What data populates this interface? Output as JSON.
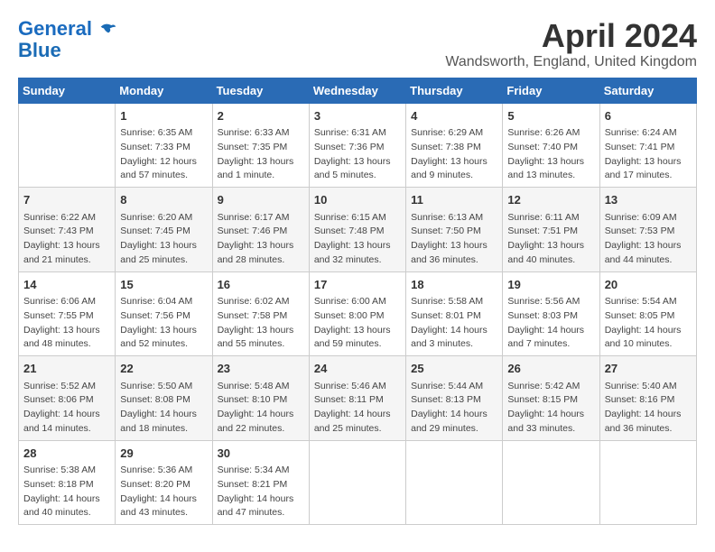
{
  "header": {
    "logo_line1": "General",
    "logo_line2": "Blue",
    "title": "April 2024",
    "location": "Wandsworth, England, United Kingdom"
  },
  "days_of_week": [
    "Sunday",
    "Monday",
    "Tuesday",
    "Wednesday",
    "Thursday",
    "Friday",
    "Saturday"
  ],
  "weeks": [
    [
      {
        "day": "",
        "sunrise": "",
        "sunset": "",
        "daylight": ""
      },
      {
        "day": "1",
        "sunrise": "Sunrise: 6:35 AM",
        "sunset": "Sunset: 7:33 PM",
        "daylight": "Daylight: 12 hours and 57 minutes."
      },
      {
        "day": "2",
        "sunrise": "Sunrise: 6:33 AM",
        "sunset": "Sunset: 7:35 PM",
        "daylight": "Daylight: 13 hours and 1 minute."
      },
      {
        "day": "3",
        "sunrise": "Sunrise: 6:31 AM",
        "sunset": "Sunset: 7:36 PM",
        "daylight": "Daylight: 13 hours and 5 minutes."
      },
      {
        "day": "4",
        "sunrise": "Sunrise: 6:29 AM",
        "sunset": "Sunset: 7:38 PM",
        "daylight": "Daylight: 13 hours and 9 minutes."
      },
      {
        "day": "5",
        "sunrise": "Sunrise: 6:26 AM",
        "sunset": "Sunset: 7:40 PM",
        "daylight": "Daylight: 13 hours and 13 minutes."
      },
      {
        "day": "6",
        "sunrise": "Sunrise: 6:24 AM",
        "sunset": "Sunset: 7:41 PM",
        "daylight": "Daylight: 13 hours and 17 minutes."
      }
    ],
    [
      {
        "day": "7",
        "sunrise": "Sunrise: 6:22 AM",
        "sunset": "Sunset: 7:43 PM",
        "daylight": "Daylight: 13 hours and 21 minutes."
      },
      {
        "day": "8",
        "sunrise": "Sunrise: 6:20 AM",
        "sunset": "Sunset: 7:45 PM",
        "daylight": "Daylight: 13 hours and 25 minutes."
      },
      {
        "day": "9",
        "sunrise": "Sunrise: 6:17 AM",
        "sunset": "Sunset: 7:46 PM",
        "daylight": "Daylight: 13 hours and 28 minutes."
      },
      {
        "day": "10",
        "sunrise": "Sunrise: 6:15 AM",
        "sunset": "Sunset: 7:48 PM",
        "daylight": "Daylight: 13 hours and 32 minutes."
      },
      {
        "day": "11",
        "sunrise": "Sunrise: 6:13 AM",
        "sunset": "Sunset: 7:50 PM",
        "daylight": "Daylight: 13 hours and 36 minutes."
      },
      {
        "day": "12",
        "sunrise": "Sunrise: 6:11 AM",
        "sunset": "Sunset: 7:51 PM",
        "daylight": "Daylight: 13 hours and 40 minutes."
      },
      {
        "day": "13",
        "sunrise": "Sunrise: 6:09 AM",
        "sunset": "Sunset: 7:53 PM",
        "daylight": "Daylight: 13 hours and 44 minutes."
      }
    ],
    [
      {
        "day": "14",
        "sunrise": "Sunrise: 6:06 AM",
        "sunset": "Sunset: 7:55 PM",
        "daylight": "Daylight: 13 hours and 48 minutes."
      },
      {
        "day": "15",
        "sunrise": "Sunrise: 6:04 AM",
        "sunset": "Sunset: 7:56 PM",
        "daylight": "Daylight: 13 hours and 52 minutes."
      },
      {
        "day": "16",
        "sunrise": "Sunrise: 6:02 AM",
        "sunset": "Sunset: 7:58 PM",
        "daylight": "Daylight: 13 hours and 55 minutes."
      },
      {
        "day": "17",
        "sunrise": "Sunrise: 6:00 AM",
        "sunset": "Sunset: 8:00 PM",
        "daylight": "Daylight: 13 hours and 59 minutes."
      },
      {
        "day": "18",
        "sunrise": "Sunrise: 5:58 AM",
        "sunset": "Sunset: 8:01 PM",
        "daylight": "Daylight: 14 hours and 3 minutes."
      },
      {
        "day": "19",
        "sunrise": "Sunrise: 5:56 AM",
        "sunset": "Sunset: 8:03 PM",
        "daylight": "Daylight: 14 hours and 7 minutes."
      },
      {
        "day": "20",
        "sunrise": "Sunrise: 5:54 AM",
        "sunset": "Sunset: 8:05 PM",
        "daylight": "Daylight: 14 hours and 10 minutes."
      }
    ],
    [
      {
        "day": "21",
        "sunrise": "Sunrise: 5:52 AM",
        "sunset": "Sunset: 8:06 PM",
        "daylight": "Daylight: 14 hours and 14 minutes."
      },
      {
        "day": "22",
        "sunrise": "Sunrise: 5:50 AM",
        "sunset": "Sunset: 8:08 PM",
        "daylight": "Daylight: 14 hours and 18 minutes."
      },
      {
        "day": "23",
        "sunrise": "Sunrise: 5:48 AM",
        "sunset": "Sunset: 8:10 PM",
        "daylight": "Daylight: 14 hours and 22 minutes."
      },
      {
        "day": "24",
        "sunrise": "Sunrise: 5:46 AM",
        "sunset": "Sunset: 8:11 PM",
        "daylight": "Daylight: 14 hours and 25 minutes."
      },
      {
        "day": "25",
        "sunrise": "Sunrise: 5:44 AM",
        "sunset": "Sunset: 8:13 PM",
        "daylight": "Daylight: 14 hours and 29 minutes."
      },
      {
        "day": "26",
        "sunrise": "Sunrise: 5:42 AM",
        "sunset": "Sunset: 8:15 PM",
        "daylight": "Daylight: 14 hours and 33 minutes."
      },
      {
        "day": "27",
        "sunrise": "Sunrise: 5:40 AM",
        "sunset": "Sunset: 8:16 PM",
        "daylight": "Daylight: 14 hours and 36 minutes."
      }
    ],
    [
      {
        "day": "28",
        "sunrise": "Sunrise: 5:38 AM",
        "sunset": "Sunset: 8:18 PM",
        "daylight": "Daylight: 14 hours and 40 minutes."
      },
      {
        "day": "29",
        "sunrise": "Sunrise: 5:36 AM",
        "sunset": "Sunset: 8:20 PM",
        "daylight": "Daylight: 14 hours and 43 minutes."
      },
      {
        "day": "30",
        "sunrise": "Sunrise: 5:34 AM",
        "sunset": "Sunset: 8:21 PM",
        "daylight": "Daylight: 14 hours and 47 minutes."
      },
      {
        "day": "",
        "sunrise": "",
        "sunset": "",
        "daylight": ""
      },
      {
        "day": "",
        "sunrise": "",
        "sunset": "",
        "daylight": ""
      },
      {
        "day": "",
        "sunrise": "",
        "sunset": "",
        "daylight": ""
      },
      {
        "day": "",
        "sunrise": "",
        "sunset": "",
        "daylight": ""
      }
    ]
  ]
}
